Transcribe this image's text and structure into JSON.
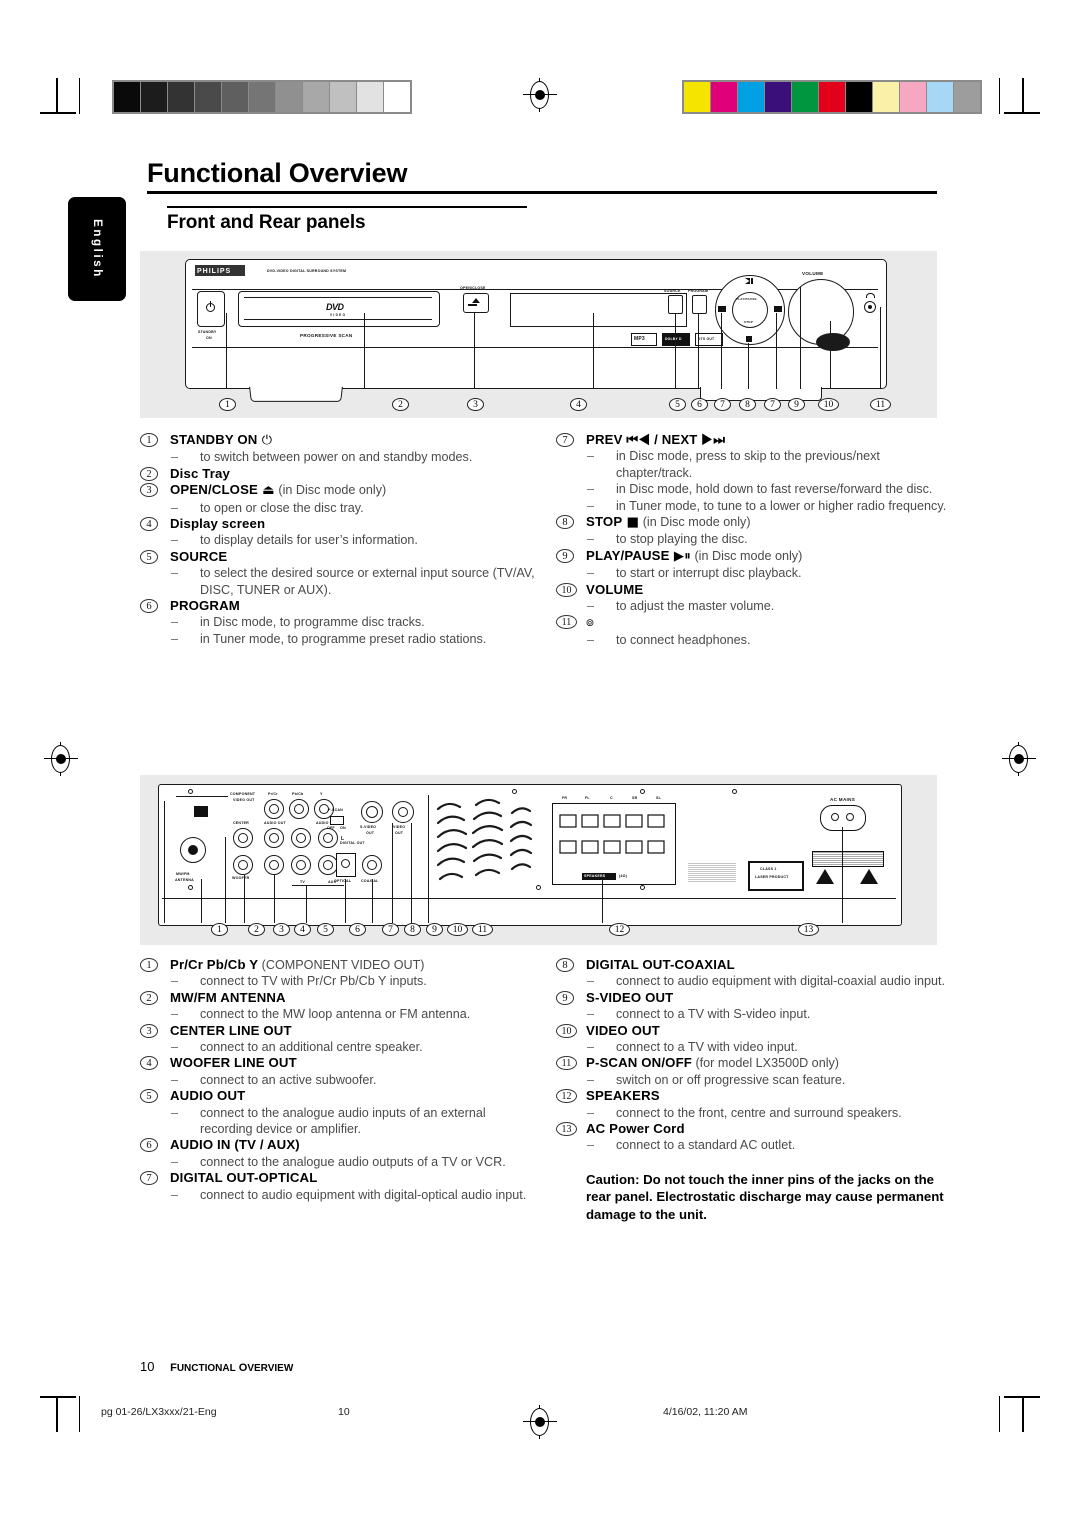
{
  "page": {
    "language_tab": "English",
    "title": "Functional Overview",
    "subtitle": "Front and Rear panels",
    "running_head_page": "10",
    "running_head_text": "Functional Overview",
    "footer_left": "pg 01-26/LX3xxx/21-Eng",
    "footer_page": "10",
    "footer_right": "4/16/02, 11:20 AM"
  },
  "colorbar": {
    "grayscale": [
      "#0a0a0a",
      "#1c1c1c",
      "#333333",
      "#4a4a4a",
      "#5f5f5f",
      "#757575",
      "#909090",
      "#a8a8a8",
      "#c0c0c0",
      "#e2e2e2",
      "#ffffff"
    ],
    "colors": [
      "#f5e400",
      "#e0007a",
      "#00a0e2",
      "#3b0f7a",
      "#009640",
      "#e2001a",
      "#000000",
      "#fbf0a8",
      "#f6a8c2",
      "#a6d8f5",
      "#9d9d9d"
    ]
  },
  "front_panel": {
    "brand": "PHILIPS",
    "system_label": "DVD-VIDEO DIGITAL SURROUND SYSTEM",
    "standby_label": "STANDBY\nON",
    "disc_logo": "DVD",
    "disc_logo_sub": "V I D E O",
    "progressive": "PROGRESSIVE SCAN",
    "open_close": "OPEN/CLOSE",
    "source": "SOURCE",
    "program": "PROGRAM",
    "volume": "VOLUME",
    "jog_play_pause": "PLAY/PAUSE",
    "jog_stop": "STOP",
    "badges": [
      "MP3",
      "DOLBY DIGITAL",
      "DTS DIGITAL OUT"
    ],
    "callouts": [
      "1",
      "2",
      "3",
      "4",
      "5",
      "6",
      "7",
      "8",
      "7",
      "9",
      "10",
      "11"
    ]
  },
  "rear_panel": {
    "component_video_out": "COMPONENT VIDEO OUT",
    "component_jacks": [
      "Pr/Cr",
      "Pb/Cb",
      "Y"
    ],
    "mw_fm_antenna": "MW/FM ANTENNA",
    "center_line_out": "CENTER LINE OUT",
    "woofer_line_out": "WOOFER LINE OUT",
    "audio_out": "AUDIO OUT",
    "audio_in": "AUDIO IN",
    "tv": "TV",
    "aux": "AUX",
    "left_ch": "L",
    "right_ch": "R",
    "p_scan": "P-SCAN",
    "p_scan_off": "OFF",
    "p_scan_on": "ON",
    "digital_out": "DIGITAL OUT",
    "optical": "OPTICAL",
    "coaxial": "COAXIAL",
    "s_video_out": "S-VIDEO OUT",
    "video_out": "VIDEO OUT",
    "speakers_label": "SPEAKERS",
    "speakers_ohm": "(4Ω)",
    "speaker_terminals": [
      "FR",
      "FL",
      "C",
      "SR",
      "SL"
    ],
    "ac_mains": "AC MAINS",
    "laser_label": "CLASS 1\nLASER PRODUCT",
    "callouts": [
      "1",
      "2",
      "3",
      "4",
      "5",
      "6",
      "7",
      "8",
      "9",
      "10",
      "11",
      "12",
      "13"
    ]
  },
  "front_items": [
    {
      "num": "1",
      "heading": "STANDBY ON",
      "heading_glyph": "⏻",
      "heading_suffix": "",
      "bullets": [
        "to switch between power on and standby modes."
      ]
    },
    {
      "num": "2",
      "heading": "Disc Tray",
      "heading_glyph": "",
      "heading_suffix": "",
      "bullets": []
    },
    {
      "num": "3",
      "heading": "OPEN/CLOSE",
      "heading_glyph": "⏏",
      "heading_suffix": "(in Disc mode only)",
      "bullets": [
        "to open or close the disc tray."
      ]
    },
    {
      "num": "4",
      "heading": "Display screen",
      "heading_glyph": "",
      "heading_suffix": "",
      "bullets": [
        "to display details for user’s information."
      ]
    },
    {
      "num": "5",
      "heading": "SOURCE",
      "heading_glyph": "",
      "heading_suffix": "",
      "bullets": [
        "to select the desired source or external input source (TV/AV, DISC, TUNER or AUX)."
      ]
    },
    {
      "num": "6",
      "heading": "PROGRAM",
      "heading_glyph": "",
      "heading_suffix": "",
      "bullets": [
        "in Disc mode, to programme disc tracks.",
        "in Tuner mode, to programme preset radio stations."
      ]
    },
    {
      "num": "7",
      "heading": "PREV ⏮◀ / NEXT  ▶⏭",
      "heading_glyph": "",
      "heading_suffix": "",
      "bullets": [
        "in Disc mode, press to skip to the previous/next chapter/track.",
        "in Disc mode, hold down to fast reverse/forward the disc.",
        "in Tuner mode, to tune to a lower or higher radio frequency."
      ]
    },
    {
      "num": "8",
      "heading": "STOP",
      "heading_glyph": "■",
      "heading_suffix": "(in Disc mode only)",
      "bullets": [
        "to stop playing the disc."
      ]
    },
    {
      "num": "9",
      "heading": "PLAY/PAUSE",
      "heading_glyph": "▶⏸",
      "heading_suffix": "(in Disc mode only)",
      "bullets": [
        "to start or interrupt disc playback."
      ]
    },
    {
      "num": "10",
      "heading": "VOLUME",
      "heading_glyph": "",
      "heading_suffix": "",
      "bullets": [
        "to adjust the master volume."
      ]
    },
    {
      "num": "11",
      "heading": "",
      "heading_glyph": "๏",
      "heading_suffix": "",
      "bullets": [
        "to connect headphones."
      ]
    }
  ],
  "rear_items": [
    {
      "num": "1",
      "heading": "Pr/Cr Pb/Cb Y",
      "heading_suffix": "(COMPONENT VIDEO OUT)",
      "bullets": [
        "connect to TV with Pr/Cr Pb/Cb Y inputs."
      ]
    },
    {
      "num": "2",
      "heading": "MW/FM ANTENNA",
      "heading_suffix": "",
      "bullets": [
        "connect to the MW loop antenna or FM antenna."
      ]
    },
    {
      "num": "3",
      "heading": "CENTER LINE OUT",
      "heading_suffix": "",
      "bullets": [
        "connect to an additional centre speaker."
      ]
    },
    {
      "num": "4",
      "heading": "WOOFER LINE OUT",
      "heading_suffix": "",
      "bullets": [
        "connect to an active subwoofer."
      ]
    },
    {
      "num": "5",
      "heading": "AUDIO OUT",
      "heading_suffix": "",
      "bullets": [
        "connect to the analogue audio inputs of an external recording device or amplifier."
      ]
    },
    {
      "num": "6",
      "heading": "AUDIO IN (TV / AUX)",
      "heading_suffix": "",
      "bullets": [
        "connect to the analogue audio outputs of a TV or VCR."
      ]
    },
    {
      "num": "7",
      "heading": "DIGITAL OUT-OPTICAL",
      "heading_suffix": "",
      "bullets": [
        "connect to audio equipment with digital-optical audio input."
      ]
    },
    {
      "num": "8",
      "heading": "DIGITAL OUT-COAXIAL",
      "heading_suffix": "",
      "bullets": [
        "connect to audio equipment with digital-coaxial audio input."
      ]
    },
    {
      "num": "9",
      "heading": "S-VIDEO OUT",
      "heading_suffix": "",
      "bullets": [
        "connect to a TV with S-video input."
      ]
    },
    {
      "num": "10",
      "heading": "VIDEO OUT",
      "heading_suffix": "",
      "bullets": [
        "connect to a TV with video input."
      ]
    },
    {
      "num": "11",
      "heading": "P-SCAN ON/OFF",
      "heading_suffix": "(for model LX3500D only)",
      "bullets": [
        "switch on or off progressive scan feature."
      ]
    },
    {
      "num": "12",
      "heading": "SPEAKERS",
      "heading_suffix": "",
      "bullets": [
        "connect to the front, centre and surround speakers."
      ]
    },
    {
      "num": "13",
      "heading": "AC Power Cord",
      "heading_suffix": "",
      "bullets": [
        "connect to a standard AC outlet."
      ]
    }
  ],
  "caution": "Caution: Do not touch the inner pins of the jacks on the rear panel. Electrostatic discharge may cause permanent damage to the unit."
}
